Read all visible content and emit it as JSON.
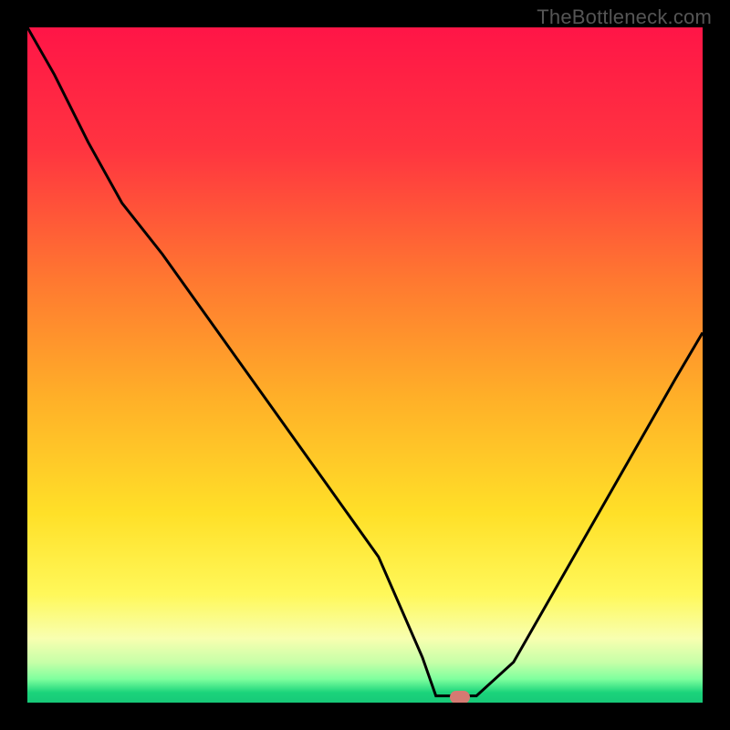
{
  "watermark": "TheBottleneck.com",
  "marker": {
    "color": "#d57a72",
    "x_frac": 0.64,
    "y_frac": 0.992
  },
  "chart_data": {
    "type": "line",
    "title": "",
    "xlabel": "",
    "ylabel": "",
    "xlim": [
      0,
      1
    ],
    "ylim": [
      0,
      1
    ],
    "x": [
      0.0,
      0.04,
      0.09,
      0.14,
      0.2,
      0.28,
      0.36,
      0.44,
      0.52,
      0.585,
      0.605,
      0.665,
      0.72,
      0.8,
      0.88,
      0.96,
      1.0
    ],
    "values": [
      1.0,
      0.93,
      0.83,
      0.74,
      0.664,
      0.552,
      0.44,
      0.328,
      0.216,
      0.067,
      0.01,
      0.01,
      0.06,
      0.2,
      0.34,
      0.48,
      0.548
    ],
    "gradient_stops": [
      {
        "pos": 0.0,
        "color": "#ff1547"
      },
      {
        "pos": 0.18,
        "color": "#ff3440"
      },
      {
        "pos": 0.38,
        "color": "#ff7a30"
      },
      {
        "pos": 0.55,
        "color": "#ffb028"
      },
      {
        "pos": 0.72,
        "color": "#ffe028"
      },
      {
        "pos": 0.84,
        "color": "#fff85a"
      },
      {
        "pos": 0.905,
        "color": "#f8ffb0"
      },
      {
        "pos": 0.94,
        "color": "#c7ffa8"
      },
      {
        "pos": 0.965,
        "color": "#7fff9e"
      },
      {
        "pos": 0.985,
        "color": "#1bd47b"
      },
      {
        "pos": 1.0,
        "color": "#17c978"
      }
    ]
  }
}
